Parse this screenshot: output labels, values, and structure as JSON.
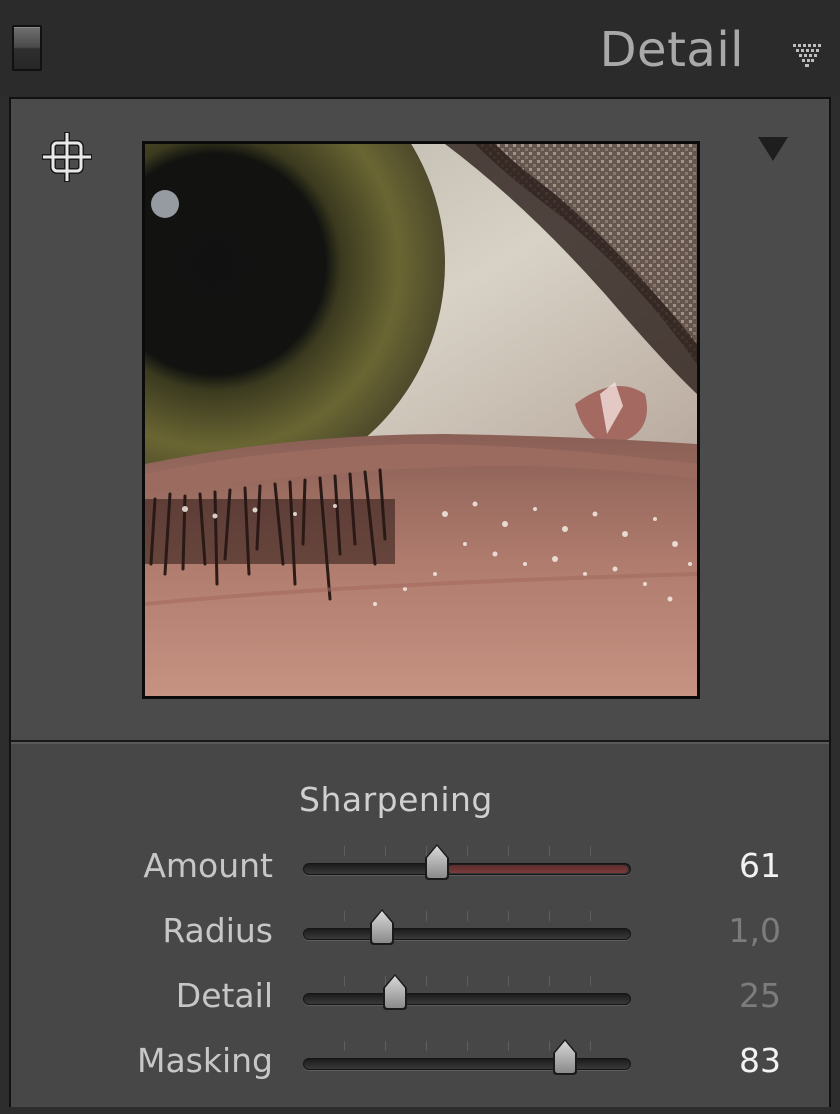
{
  "header": {
    "title": "Detail"
  },
  "colors": {
    "panel_bg": "#4a4a4a",
    "header_bg": "#2b2b2b",
    "amount_tint": "#7a3a3a"
  },
  "icons": {
    "toggle": "panel-toggle-switch",
    "menu": "panel-menu-triangle",
    "target": "crosshair-target",
    "collapse": "collapse-triangle"
  },
  "sharpening": {
    "title": "Sharpening",
    "sliders": [
      {
        "label": "Amount",
        "value": "61",
        "fraction": 0.41,
        "range": [
          0,
          150
        ],
        "tinted": true,
        "bright": true
      },
      {
        "label": "Radius",
        "value": "1,0",
        "fraction": 0.24,
        "range": [
          0.5,
          3.0
        ],
        "tinted": false,
        "bright": false
      },
      {
        "label": "Detail",
        "value": "25",
        "fraction": 0.28,
        "range": [
          0,
          100
        ],
        "tinted": false,
        "bright": false
      },
      {
        "label": "Masking",
        "value": "83",
        "fraction": 0.8,
        "range": [
          0,
          100
        ],
        "tinted": false,
        "bright": true
      }
    ]
  }
}
